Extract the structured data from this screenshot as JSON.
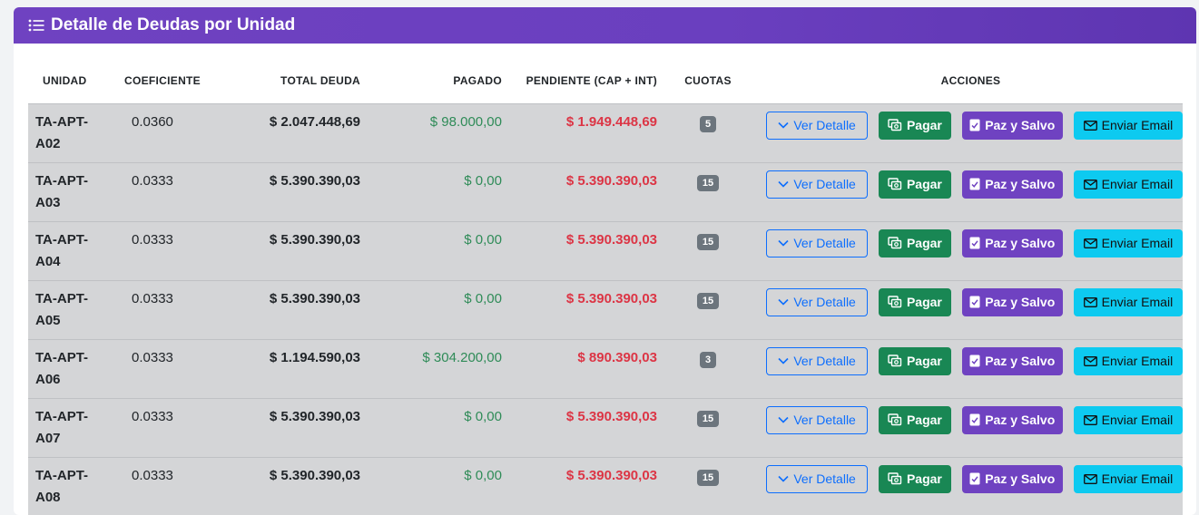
{
  "header": {
    "title": "Detalle de Deudas por Unidad",
    "icon": "list-icon"
  },
  "table": {
    "columns": [
      "UNIDAD",
      "COEFICIENTE",
      "TOTAL DEUDA",
      "PAGADO",
      "PENDIENTE (CAP + INT)",
      "CUOTAS",
      "ACCIONES"
    ],
    "actions": {
      "detail": "Ver Detalle",
      "pay": "Pagar",
      "paz": "Paz y Salvo",
      "email": "Enviar Email"
    },
    "rows": [
      {
        "unit_line1": "TA-APT-",
        "unit_line2": "A02",
        "coef": "0.0360",
        "total": "$ 2.047.448,69",
        "paid": "$ 98.000,00",
        "pending": "$ 1.949.448,69",
        "cuotas": "5"
      },
      {
        "unit_line1": "TA-APT-",
        "unit_line2": "A03",
        "coef": "0.0333",
        "total": "$ 5.390.390,03",
        "paid": "$ 0,00",
        "pending": "$ 5.390.390,03",
        "cuotas": "15"
      },
      {
        "unit_line1": "TA-APT-",
        "unit_line2": "A04",
        "coef": "0.0333",
        "total": "$ 5.390.390,03",
        "paid": "$ 0,00",
        "pending": "$ 5.390.390,03",
        "cuotas": "15"
      },
      {
        "unit_line1": "TA-APT-",
        "unit_line2": "A05",
        "coef": "0.0333",
        "total": "$ 5.390.390,03",
        "paid": "$ 0,00",
        "pending": "$ 5.390.390,03",
        "cuotas": "15"
      },
      {
        "unit_line1": "TA-APT-",
        "unit_line2": "A06",
        "coef": "0.0333",
        "total": "$ 1.194.590,03",
        "paid": "$ 304.200,00",
        "pending": "$ 890.390,03",
        "cuotas": "3"
      },
      {
        "unit_line1": "TA-APT-",
        "unit_line2": "A07",
        "coef": "0.0333",
        "total": "$ 5.390.390,03",
        "paid": "$ 0,00",
        "pending": "$ 5.390.390,03",
        "cuotas": "15"
      },
      {
        "unit_line1": "TA-APT-",
        "unit_line2": "A08",
        "coef": "0.0333",
        "total": "$ 5.390.390,03",
        "paid": "$ 0,00",
        "pending": "$ 5.390.390,03",
        "cuotas": "15"
      }
    ]
  },
  "colors": {
    "header_bg": "#6f42c1",
    "paid": "#2e8b57",
    "pending": "#dc3545",
    "pay_btn": "#198754",
    "paz_btn": "#6f42c1",
    "email_btn": "#0dcaf0",
    "detail_btn": "#0d6efd"
  }
}
